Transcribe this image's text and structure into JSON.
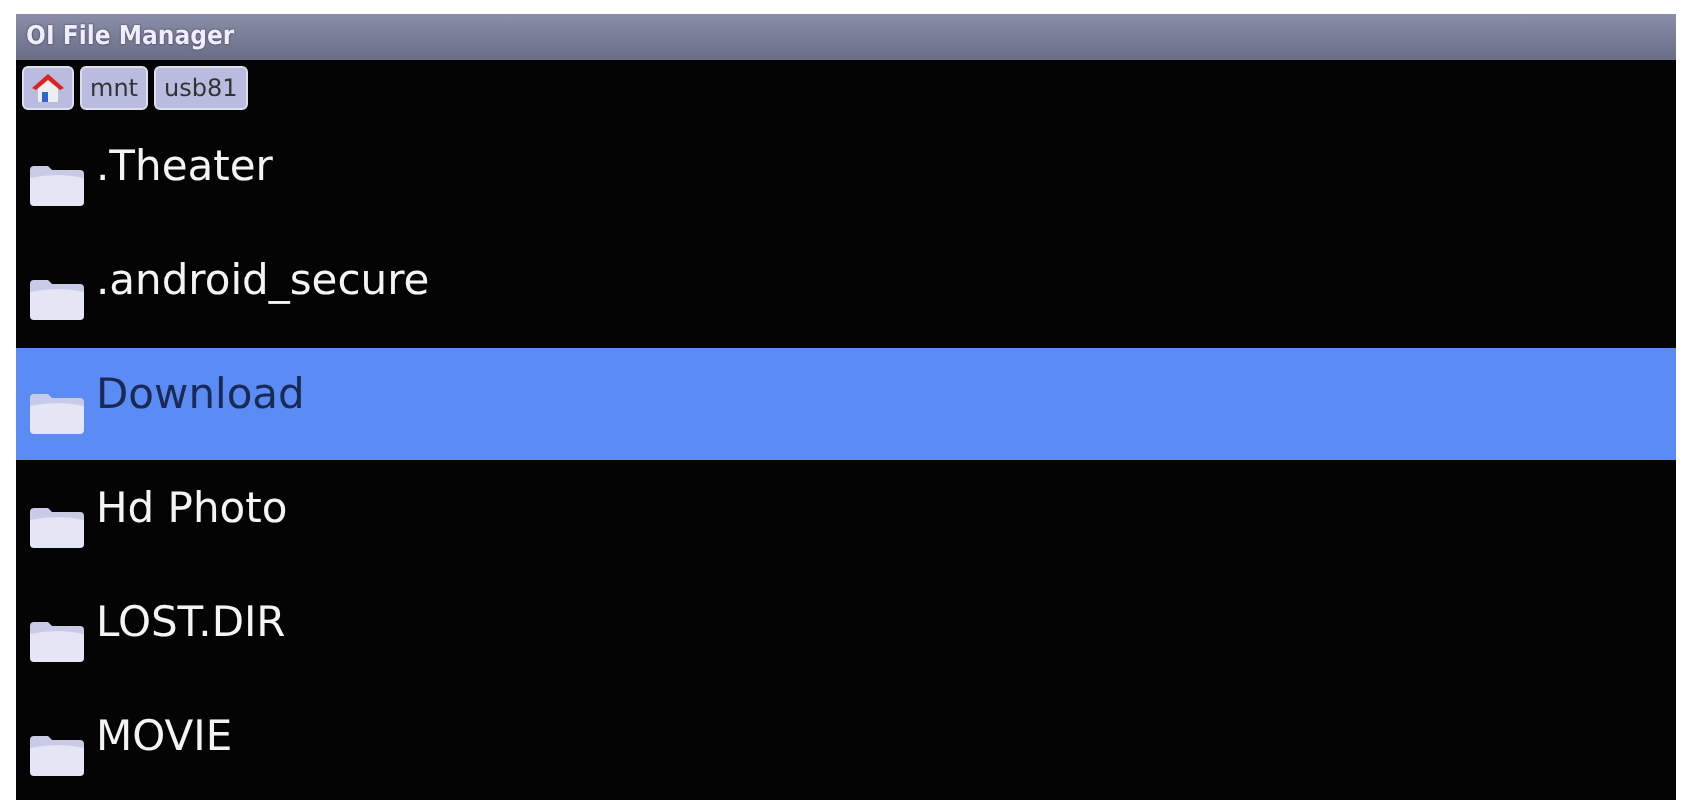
{
  "window": {
    "title": "OI File Manager"
  },
  "breadcrumbs": [
    {
      "kind": "home"
    },
    {
      "kind": "folder",
      "label": "mnt"
    },
    {
      "kind": "folder",
      "label": "usb81"
    }
  ],
  "files": [
    {
      "name": ".Theater",
      "selected": false
    },
    {
      "name": ".android_secure",
      "selected": false
    },
    {
      "name": "Download",
      "selected": true
    },
    {
      "name": "Hd Photo",
      "selected": false
    },
    {
      "name": "LOST.DIR",
      "selected": false
    },
    {
      "name": "MOVIE",
      "selected": false
    }
  ]
}
